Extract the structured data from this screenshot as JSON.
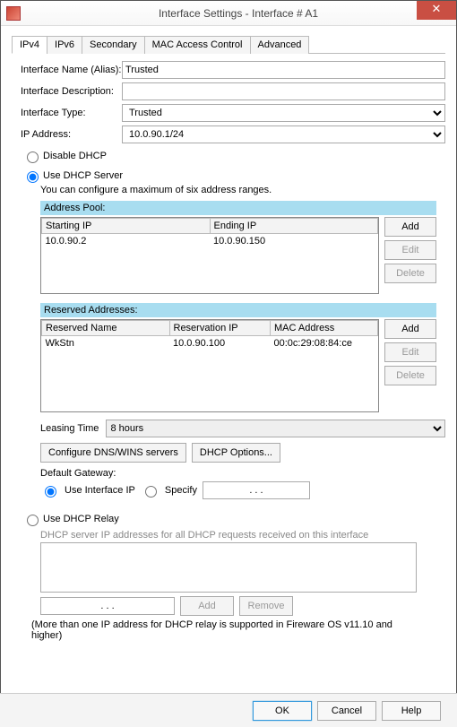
{
  "window": {
    "title": "Interface Settings - Interface # A1",
    "close_glyph": "✕"
  },
  "tabs": [
    "IPv4",
    "IPv6",
    "Secondary",
    "MAC Access Control",
    "Advanced"
  ],
  "active_tab": 0,
  "labels": {
    "name": "Interface Name (Alias):",
    "desc": "Interface Description:",
    "type": "Interface Type:",
    "ip": "IP Address:"
  },
  "values": {
    "name": "Trusted",
    "desc": "",
    "type": "Trusted",
    "ip": "10.0.90.1/24"
  },
  "dhcp": {
    "disable": "Disable DHCP",
    "server": "Use DHCP Server",
    "relay": "Use DHCP Relay",
    "selected": "server",
    "hint": "You can configure a maximum of six address ranges.",
    "pool_hdr": "Address Pool:",
    "pool_cols": [
      "Starting IP",
      "Ending IP"
    ],
    "pool_rows": [
      {
        "start": "10.0.90.2",
        "end": "10.0.90.150"
      }
    ],
    "res_hdr": "Reserved Addresses:",
    "res_cols": [
      "Reserved Name",
      "Reservation IP",
      "MAC Address"
    ],
    "res_rows": [
      {
        "name": "WkStn",
        "ip": "10.0.90.100",
        "mac": "00:0c:29:08:84:ce"
      }
    ],
    "btns": {
      "add": "Add",
      "edit": "Edit",
      "delete": "Delete"
    },
    "leasing_label": "Leasing Time",
    "leasing_value": "8 hours",
    "dns_btn": "Configure DNS/WINS servers",
    "opts_btn": "DHCP Options...",
    "gw_label": "Default Gateway:",
    "gw_use_if": "Use Interface IP",
    "gw_specify": "Specify",
    "gw_specify_val": ".       .       .",
    "relay_hint": "DHCP server IP addresses for all DHCP requests received on this interface",
    "relay_ip": ".       .       .",
    "relay_add": "Add",
    "relay_remove": "Remove",
    "note": "(More than one IP address for DHCP relay is supported in Fireware OS v11.10 and higher)"
  },
  "footer": {
    "ok": "OK",
    "cancel": "Cancel",
    "help": "Help"
  }
}
